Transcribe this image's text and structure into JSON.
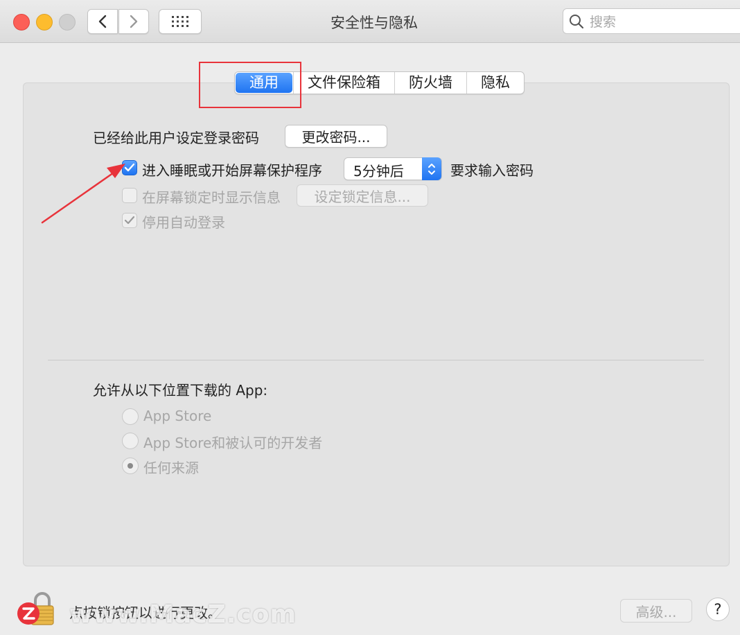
{
  "window": {
    "title": "安全性与隐私"
  },
  "search": {
    "placeholder": "搜索"
  },
  "tabs": [
    {
      "label": "通用",
      "active": true
    },
    {
      "label": "文件保险箱",
      "active": false
    },
    {
      "label": "防火墙",
      "active": false
    },
    {
      "label": "隐私",
      "active": false
    }
  ],
  "general": {
    "password_set_label": "已经给此用户设定登录密码",
    "change_password_button": "更改密码...",
    "require_password": {
      "label_before": "进入睡眠或开始屏幕保护程序",
      "selected_delay": "5分钟后",
      "label_after": "要求输入密码",
      "checked": true
    },
    "show_message": {
      "label": "在屏幕锁定时显示信息",
      "button": "设定锁定信息...",
      "checked": false
    },
    "disable_autologin": {
      "label": "停用自动登录",
      "checked": true
    }
  },
  "downloads": {
    "heading": "允许从以下位置下载的 App:",
    "options": [
      {
        "label": "App Store",
        "selected": false
      },
      {
        "label": "App Store和被认可的开发者",
        "selected": false
      },
      {
        "label": "任何来源",
        "selected": true
      }
    ]
  },
  "footer": {
    "lock_text": "点按锁按钮以进行更改。",
    "advanced_button": "高级...",
    "help_button": "?"
  },
  "watermark": {
    "text": "www.MacZ.com"
  },
  "colors": {
    "accent": "#1f74f1",
    "annotation": "#e8333b",
    "close": "#fc5f57",
    "minimize": "#fdbc2e"
  }
}
